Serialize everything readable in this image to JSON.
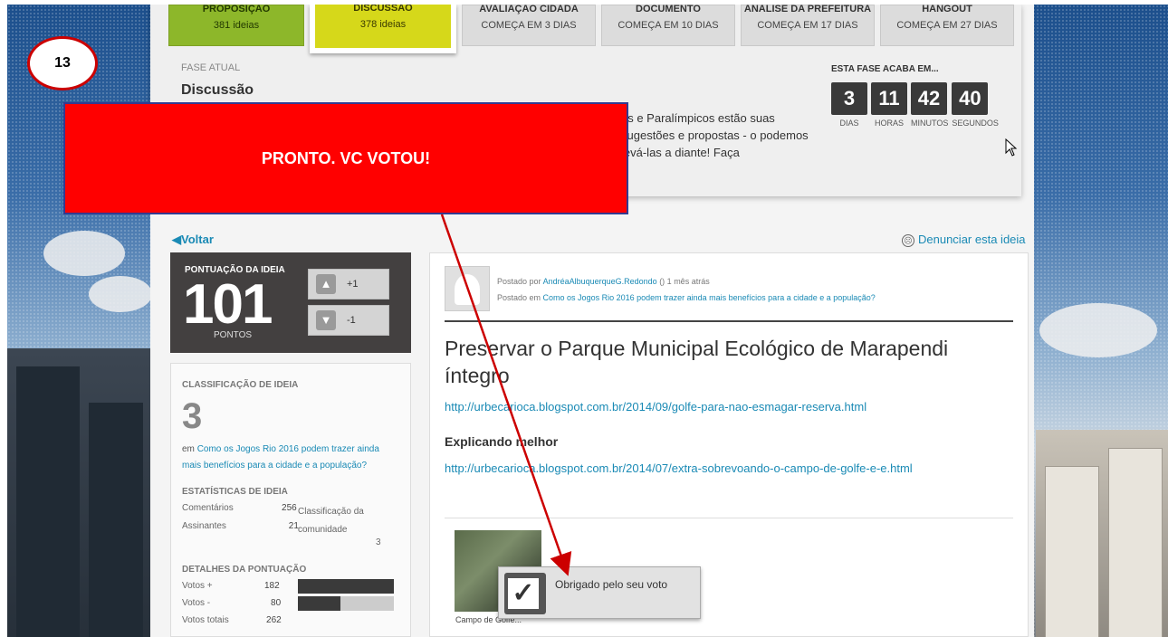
{
  "step": "13",
  "callout_text": "PRONTO. VC VOTOU!",
  "tabs": [
    {
      "title": "PROPOSIÇÃO",
      "sub": "381 ideias"
    },
    {
      "title": "DISCUSSÃO",
      "sub": "378 ideias"
    },
    {
      "title": "AVALIAÇÃO CIDADÃ",
      "sub": "COMEÇA EM 3 DIAS"
    },
    {
      "title": "DOCUMENTO",
      "sub": "COMEÇA EM 10 DIAS"
    },
    {
      "title": "ANÁLISE DA PREFEITURA",
      "sub": "COMEÇA EM 17 DIAS"
    },
    {
      "title": "HANGOUT",
      "sub": "COMEÇA EM 27 DIAS"
    }
  ],
  "phase": {
    "label": "FASE ATUAL",
    "name": "Discussão",
    "desc": "os e Paralímpicos estão suas sugestões e propostas - o podemos levá-las a diante! Faça"
  },
  "countdown": {
    "label": "ESTA FASE ACABA EM...",
    "items": [
      {
        "value": "3",
        "unit": "DIAS"
      },
      {
        "value": "11",
        "unit": "HORAS"
      },
      {
        "value": "42",
        "unit": "MINUTOS"
      },
      {
        "value": "40",
        "unit": "SEGUNDOS"
      }
    ]
  },
  "nav": {
    "back": "Voltar",
    "report": "Denunciar esta ideia"
  },
  "score": {
    "label": "PONTUAÇÃO DA IDEIA",
    "value": "101",
    "unit": "PONTOS",
    "up": "+1",
    "down": "-1"
  },
  "classification": {
    "label": "CLASSIFICAÇÃO DE IDEIA",
    "rank": "3",
    "in_text": "em",
    "in_link": "Como os Jogos Rio 2016 podem trazer ainda mais benefícios para a cidade e a população?",
    "stats_label": "ESTATÍSTICAS DE IDEIA",
    "comments_label": "Comentários",
    "comments": "256",
    "signers_label": "Assinantes",
    "signers": "21",
    "community_label": "Classificação da comunidade",
    "community": "3",
    "details_label": "DETALHES DA PONTUAÇÃO",
    "votes_plus_label": "Votos +",
    "votes_plus": "182",
    "votes_minus_label": "Votos -",
    "votes_minus": "80",
    "votes_total_label": "Votos totais",
    "votes_total": "262",
    "plus_fraction": 1.0,
    "minus_fraction": 0.44
  },
  "idea": {
    "posted_by_prefix": "Postado por",
    "author": "AndréaAlbuquerqueG.Redondo",
    "time": "() 1 mês atrás",
    "posted_in_prefix": "Postado em",
    "posted_in": "Como os Jogos Rio 2016 podem trazer ainda mais benefícios para a cidade e a população?",
    "title": "Preservar o Parque Municipal Ecológico de Marapendi íntegro",
    "link1": "http://urbecarioca.blogspot.com.br/2014/09/golfe-para-nao-esmagar-reserva.html",
    "subheading": "Explicando melhor",
    "link2": "http://urbecarioca.blogspot.com.br/2014/07/extra-sobrevoando-o-campo-de-golfe-e-e.html",
    "thumb_caption": "Campo de Golfe..."
  },
  "toast": "Obrigado pelo seu voto",
  "colors": {
    "accent_red": "#ff0000",
    "link": "#1a8ab5",
    "tab_green": "#8db72a",
    "tab_yellow": "#d6d81a"
  }
}
